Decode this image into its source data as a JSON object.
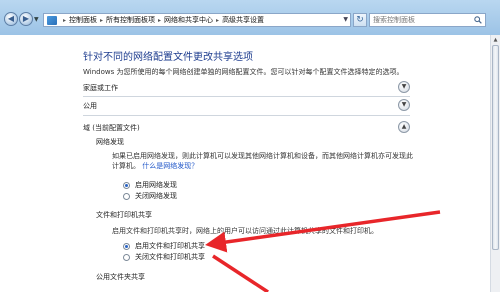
{
  "toolbar": {
    "breadcrumbs": [
      "控制面板",
      "所有控制面板项",
      "网络和共享中心",
      "高级共享设置"
    ],
    "search_placeholder": "搜索控制面板"
  },
  "page": {
    "title": "针对不同的网络配置文件更改共享选项",
    "description": "Windows 为您所使用的每个网络创建单独的网络配置文件。您可以针对每个配置文件选择特定的选项。"
  },
  "sections": [
    {
      "label": "家庭或工作"
    },
    {
      "label": "公用"
    },
    {
      "label": "域 (当前配置文件)"
    }
  ],
  "network_discovery": {
    "title": "网络发现",
    "desc_line1": "如果已启用网络发现，则此计算机可以发现其他网络计算机和设备，而其他网络计算机亦可发现此",
    "desc_line2_prefix": "计算机。",
    "link": "什么是网络发现？",
    "options": [
      "启用网络发现",
      "关闭网络发现"
    ],
    "selected": 0
  },
  "file_printer_sharing": {
    "title": "文件和打印机共享",
    "desc": "启用文件和打印机共享时，网络上的用户可以访问通过此计算机共享的文件和打印机。",
    "options": [
      "启用文件和打印机共享",
      "关闭文件和打印机共享"
    ],
    "selected": 0
  },
  "public_folder_sharing": {
    "title": "公用文件夹共享"
  },
  "colors": {
    "accent_title": "#1e3d8f",
    "link": "#1e55c8",
    "annotation_arrow": "#e8262a"
  }
}
